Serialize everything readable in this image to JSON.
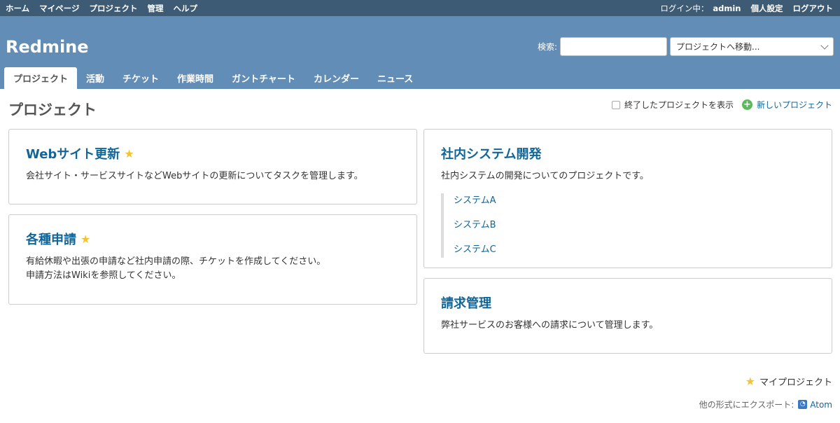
{
  "top_menu": {
    "left": [
      "ホーム",
      "マイページ",
      "プロジェクト",
      "管理",
      "ヘルプ"
    ],
    "logged_in_label": "ログイン中：",
    "user": "admin",
    "my_account": "個人設定",
    "logout": "ログアウト"
  },
  "header": {
    "title": "Redmine",
    "search_label": "検索:",
    "search_value": "",
    "jump_label": "プロジェクトへ移動..."
  },
  "main_menu": [
    "プロジェクト",
    "活動",
    "チケット",
    "作業時間",
    "ガントチャート",
    "カレンダー",
    "ニュース"
  ],
  "page": {
    "title": "プロジェクト",
    "show_closed_label": "終了したプロジェクトを表示",
    "new_project_label": "新しいプロジェクト"
  },
  "projects": [
    {
      "name": "Webサイト更新",
      "starred": true,
      "desc": [
        "会社サイト・サービスサイトなどWebサイトの更新についてタスクを管理します。"
      ]
    },
    {
      "name": "各種申請",
      "starred": true,
      "desc": [
        "有給休暇や出張の申請など社内申請の際、チケットを作成してください。",
        "申請方法はWikiを参照してください。"
      ]
    },
    {
      "name": "社内システム開発",
      "starred": false,
      "desc": [
        "社内システムの開発についてのプロジェクトです。"
      ],
      "children": [
        "システムA",
        "システムB",
        "システムC"
      ]
    },
    {
      "name": "請求管理",
      "starred": false,
      "desc": [
        "弊社サービスのお客様への請求について管理します。"
      ]
    }
  ],
  "footer": {
    "my_projects": "マイプロジェクト",
    "export_label": "他の形式にエクスポート:",
    "atom": "Atom"
  }
}
